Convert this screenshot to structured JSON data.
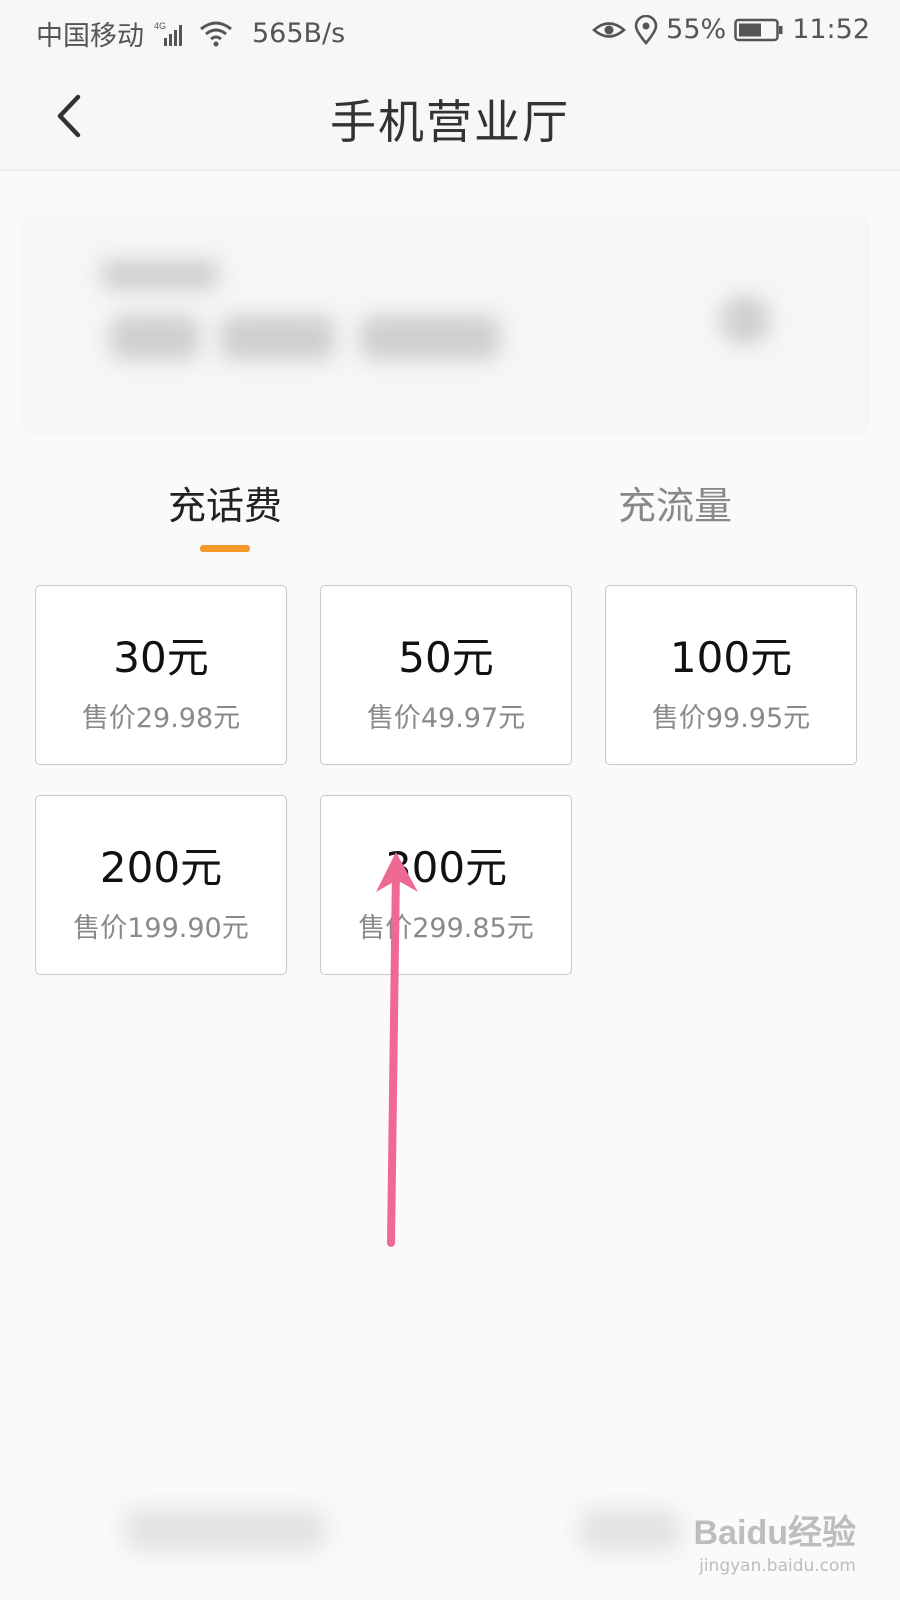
{
  "status_bar": {
    "carrier": "中国移动",
    "network_type": "4G",
    "speed": "565B/s",
    "battery": "55%",
    "time": "11:52",
    "icons": [
      "signal-icon",
      "wifi-icon",
      "eye-icon",
      "location-icon",
      "battery-icon"
    ]
  },
  "header": {
    "title": "手机营业厅",
    "back_icon": "chevron-left-icon"
  },
  "tabs": [
    {
      "label": "充话费",
      "active": true
    },
    {
      "label": "充流量",
      "active": false
    }
  ],
  "options": [
    {
      "amount": "30元",
      "price": "售价29.98元"
    },
    {
      "amount": "50元",
      "price": "售价49.97元"
    },
    {
      "amount": "100元",
      "price": "售价99.95元"
    },
    {
      "amount": "200元",
      "price": "售价199.90元"
    },
    {
      "amount": "300元",
      "price": "售价299.85元"
    }
  ],
  "watermark": {
    "main": "Baidu经验",
    "sub": "jingyan.baidu.com"
  },
  "colors": {
    "accent": "#f39a28",
    "annotation_arrow": "#ee6a93"
  }
}
